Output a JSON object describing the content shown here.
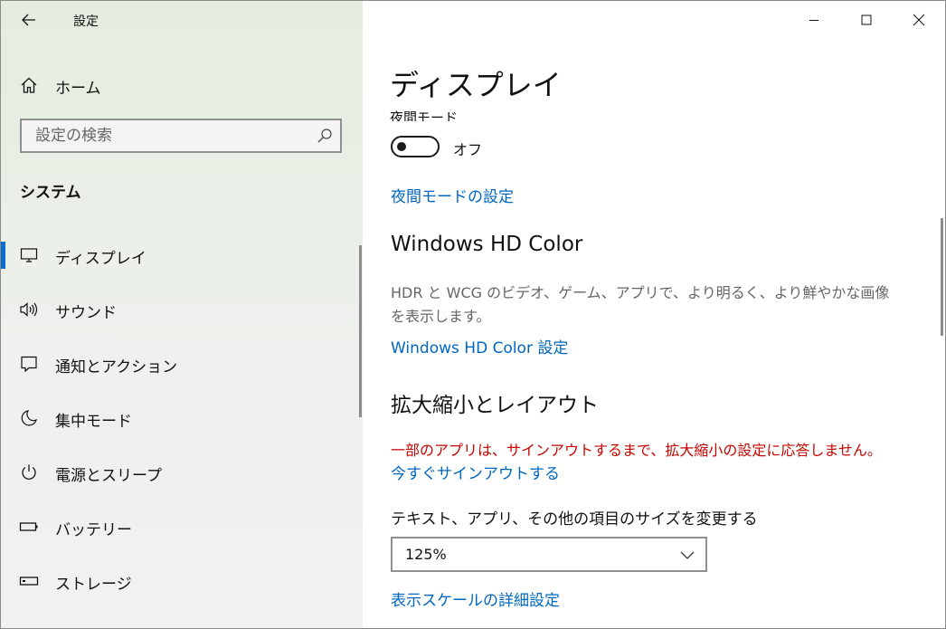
{
  "app": {
    "title": "設定"
  },
  "sidebar": {
    "home_label": "ホーム",
    "search_placeholder": "設定の検索",
    "section_title": "システム",
    "items": [
      {
        "label": "ディスプレイ",
        "icon": "monitor-icon",
        "active": true
      },
      {
        "label": "サウンド",
        "icon": "speaker-icon"
      },
      {
        "label": "通知とアクション",
        "icon": "notification-icon"
      },
      {
        "label": "集中モード",
        "icon": "moon-icon"
      },
      {
        "label": "電源とスリープ",
        "icon": "power-icon"
      },
      {
        "label": "バッテリー",
        "icon": "battery-icon"
      },
      {
        "label": "ストレージ",
        "icon": "storage-icon"
      }
    ]
  },
  "main": {
    "title": "ディスプレイ",
    "night_mode": {
      "label": "夜間モード",
      "state_label": "オフ",
      "on": false,
      "settings_link": "夜間モードの設定"
    },
    "hd_color": {
      "heading": "Windows HD Color",
      "description": "HDR と WCG のビデオ、ゲーム、アプリで、より明るく、より鮮やかな画像を表示します。",
      "link": "Windows HD Color 設定"
    },
    "scale_layout": {
      "heading": "拡大縮小とレイアウト",
      "warning": "一部のアプリは、サインアウトするまで、拡大縮小の設定に応答しません。",
      "signout_link": "今すぐサインアウトする",
      "size_label": "テキスト、アプリ、その他の項目のサイズを変更する",
      "size_value": "125%",
      "advanced_link": "表示スケールの詳細設定"
    }
  },
  "colors": {
    "accent": "#0067c0",
    "warning": "#c50500",
    "active_bar": "#0a6ed1"
  }
}
